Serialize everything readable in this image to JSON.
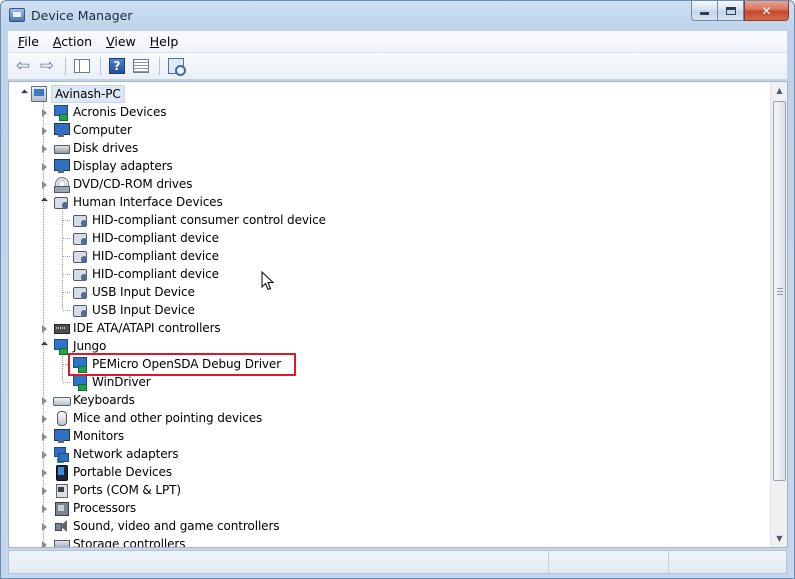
{
  "window": {
    "title": "Device Manager"
  },
  "menu": [
    {
      "label": "File",
      "accel": "F",
      "rest": "ile"
    },
    {
      "label": "Action",
      "accel": "A",
      "rest": "ction"
    },
    {
      "label": "View",
      "accel": "V",
      "rest": "iew"
    },
    {
      "label": "Help",
      "accel": "H",
      "rest": "elp"
    }
  ],
  "toolbar": {
    "icons": [
      "back-arrow-icon",
      "forward-arrow-icon",
      "show-hide-console-tree-icon",
      "help-icon",
      "properties-icon",
      "scan-hardware-changes-icon"
    ]
  },
  "tree": {
    "root": "Avinash-PC",
    "categories": [
      {
        "label": "Acronis Devices",
        "icon": "usb-device-icon"
      },
      {
        "label": "Computer",
        "icon": "computer-icon"
      },
      {
        "label": "Disk drives",
        "icon": "disk-drive-icon"
      },
      {
        "label": "Display adapters",
        "icon": "display-adapter-icon"
      },
      {
        "label": "DVD/CD-ROM drives",
        "icon": "dvd-drive-icon"
      },
      {
        "label": "Human Interface Devices",
        "icon": "hid-icon",
        "expanded": true,
        "children": [
          "HID-compliant consumer control device",
          "HID-compliant device",
          "HID-compliant device",
          "HID-compliant device",
          "USB Input Device",
          "USB Input Device"
        ]
      },
      {
        "label": "IDE ATA/ATAPI controllers",
        "icon": "ide-controller-icon"
      },
      {
        "label": "Jungo",
        "icon": "usb-device-icon",
        "expanded": true,
        "children": [
          "PEMicro OpenSDA Debug Driver",
          "WinDriver"
        ]
      },
      {
        "label": "Keyboards",
        "icon": "keyboard-icon"
      },
      {
        "label": "Mice and other pointing devices",
        "icon": "mouse-icon"
      },
      {
        "label": "Monitors",
        "icon": "monitor-icon"
      },
      {
        "label": "Network adapters",
        "icon": "network-adapter-icon"
      },
      {
        "label": "Portable Devices",
        "icon": "portable-device-icon"
      },
      {
        "label": "Ports (COM & LPT)",
        "icon": "ports-icon"
      },
      {
        "label": "Processors",
        "icon": "processor-icon"
      },
      {
        "label": "Sound, video and game controllers",
        "icon": "sound-icon"
      },
      {
        "label": "Storage controllers",
        "icon": "storage-controller-icon"
      }
    ]
  },
  "highlight": {
    "target": "PEMicro OpenSDA Debug Driver",
    "color": "#e0162b"
  },
  "colors": {
    "close_button": "#c5452c",
    "title_bar": "#bed3ea"
  }
}
